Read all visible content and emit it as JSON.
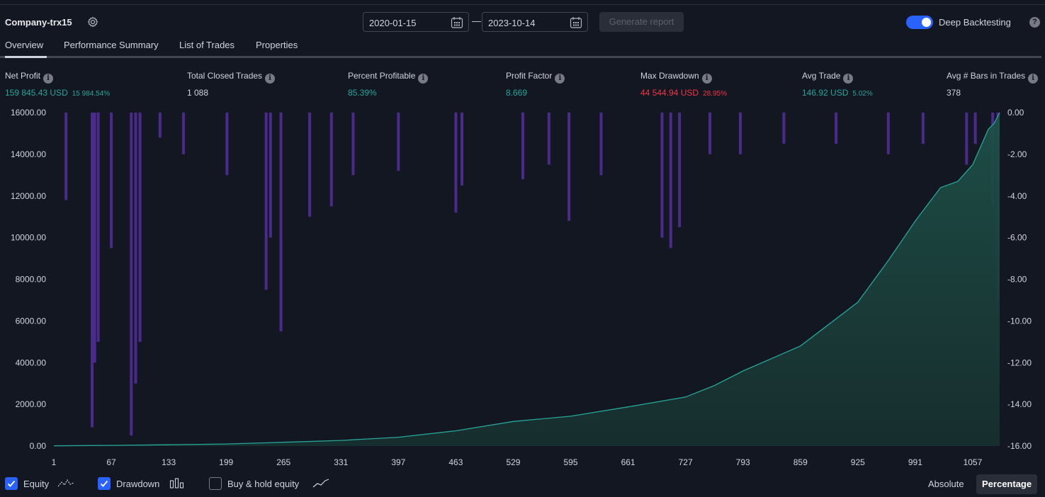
{
  "header": {
    "strategy_name": "Company-trx15",
    "date_from": "2020-01-15",
    "date_separator": "—",
    "date_to": "2023-10-14",
    "generate_label": "Generate report",
    "deep_backtesting_label": "Deep Backtesting",
    "deep_backtesting_on": true,
    "help_label": "?"
  },
  "tabs": [
    {
      "label": "Overview",
      "active": true
    },
    {
      "label": "Performance Summary",
      "active": false
    },
    {
      "label": "List of Trades",
      "active": false
    },
    {
      "label": "Properties",
      "active": false
    }
  ],
  "metrics": [
    {
      "label": "Net Profit",
      "value": "159 845.43 USD",
      "sub": "15 984.54%",
      "tone": "pos"
    },
    {
      "label": "Total Closed Trades",
      "value": "1 088",
      "sub": "",
      "tone": "neu"
    },
    {
      "label": "Percent Profitable",
      "value": "85.39%",
      "sub": "",
      "tone": "pos"
    },
    {
      "label": "Profit Factor",
      "value": "8.669",
      "sub": "",
      "tone": "pos"
    },
    {
      "label": "Max Drawdown",
      "value": "44 544.94 USD",
      "sub": "28.95%",
      "tone": "neg"
    },
    {
      "label": "Avg Trade",
      "value": "146.92 USD",
      "sub": "5.02%",
      "tone": "pos"
    },
    {
      "label": "Avg # Bars in Trades",
      "value": "378",
      "sub": "",
      "tone": "neu"
    }
  ],
  "colors": {
    "background": "#131722",
    "equity_line": "#26a69a",
    "drawdown_bars": "#4a2a8a",
    "accent": "#2962ff",
    "positive": "#26a69a",
    "negative": "#f23645"
  },
  "chart_data": {
    "type": "area",
    "x_tick_labels": [
      "1",
      "67",
      "133",
      "199",
      "265",
      "331",
      "397",
      "463",
      "529",
      "595",
      "661",
      "727",
      "793",
      "859",
      "925",
      "991",
      "1057"
    ],
    "x_ticks": [
      1,
      67,
      133,
      199,
      265,
      331,
      397,
      463,
      529,
      595,
      661,
      727,
      793,
      859,
      925,
      991,
      1057
    ],
    "xlim": [
      1,
      1088
    ],
    "left_axis": {
      "ylim": [
        0,
        16000
      ],
      "tick_labels": [
        "16000.00",
        "14000.00",
        "12000.00",
        "10000.00",
        "8000.00",
        "6000.00",
        "4000.00",
        "2000.00",
        "0.00"
      ]
    },
    "right_axis": {
      "ylim": [
        -16,
        0
      ],
      "tick_labels": [
        "0.00",
        "-2.00",
        "-4.00",
        "-6.00",
        "-8.00",
        "-10.00",
        "-12.00",
        "-14.00",
        "-16.00"
      ]
    },
    "series": [
      {
        "name": "Equity",
        "type": "area",
        "axis": "left",
        "x": [
          1,
          67,
          133,
          199,
          265,
          331,
          397,
          463,
          529,
          595,
          661,
          727,
          760,
          793,
          859,
          925,
          960,
          991,
          1020,
          1040,
          1057,
          1075,
          1082,
          1088
        ],
        "values": [
          10,
          30,
          60,
          100,
          180,
          270,
          420,
          730,
          1180,
          1430,
          1880,
          2350,
          2900,
          3600,
          4800,
          6900,
          8900,
          10800,
          12400,
          12700,
          13500,
          15200,
          15500,
          16000
        ]
      },
      {
        "name": "Drawdown",
        "type": "bar",
        "axis": "right",
        "x": [
          15,
          45,
          48,
          52,
          67,
          90,
          95,
          100,
          123,
          150,
          200,
          245,
          250,
          262,
          295,
          320,
          345,
          397,
          463,
          470,
          540,
          570,
          593,
          630,
          700,
          710,
          720,
          755,
          790,
          840,
          900,
          960,
          1000,
          1050,
          1060,
          1080,
          1086
        ],
        "values": [
          -4.2,
          -15.1,
          -12.0,
          -11.0,
          -6.5,
          -15.5,
          -13.0,
          -11.0,
          -1.2,
          -2.0,
          -3.0,
          -8.5,
          -6.0,
          -10.5,
          -5.0,
          -4.5,
          -3.0,
          -2.8,
          -4.8,
          -3.5,
          -3.2,
          -2.5,
          -5.2,
          -3.0,
          -6.0,
          -6.5,
          -5.5,
          -2.0,
          -2.0,
          -1.5,
          -1.5,
          -2.0,
          -1.5,
          -2.5,
          -1.5,
          -4.5,
          -9.0
        ]
      }
    ],
    "legend": [
      {
        "label": "Equity",
        "checked": true
      },
      {
        "label": "Drawdown",
        "checked": true
      },
      {
        "label": "Buy & hold equity",
        "checked": false
      }
    ],
    "grid": false
  },
  "view_modes": [
    {
      "label": "Absolute",
      "active": false
    },
    {
      "label": "Percentage",
      "active": true
    }
  ]
}
